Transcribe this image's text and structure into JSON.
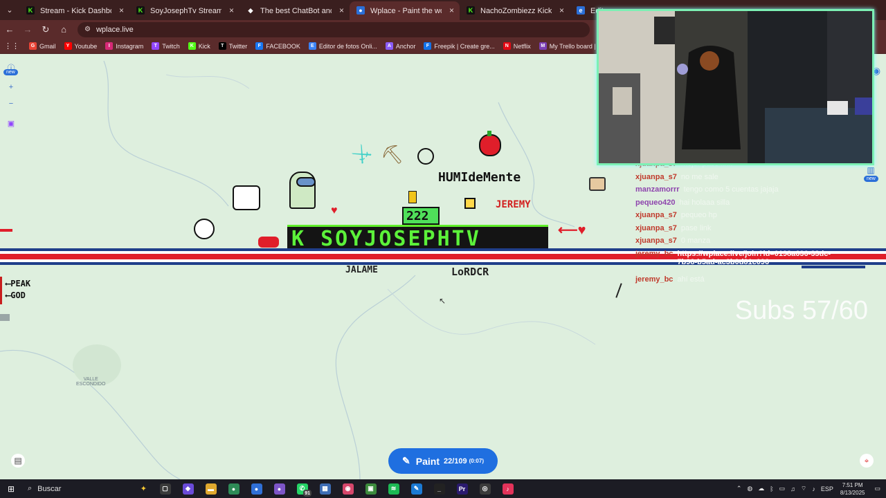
{
  "tabs": [
    {
      "label": "Stream - Kick Dashboard",
      "icon": "kick-icon",
      "active": false
    },
    {
      "label": "SoyJosephTv Stream - Watch Li",
      "icon": "kick-icon",
      "active": false
    },
    {
      "label": "The best ChatBot and Widgets",
      "icon": "botrix-icon",
      "active": false
    },
    {
      "label": "Wplace - Paint the world",
      "icon": "wplace-icon",
      "active": true
    },
    {
      "label": "NachoZombiezz Kick Font by N",
      "icon": "kick-icon",
      "active": false
    },
    {
      "label": "Edito",
      "icon": "edge-icon",
      "active": false
    }
  ],
  "address": {
    "url": "wplace.live"
  },
  "bookmarks": [
    {
      "label": "Gmail",
      "icon": "gmail-icon",
      "color": "#ea4335"
    },
    {
      "label": "Youtube",
      "icon": "youtube-icon",
      "color": "#ff0000"
    },
    {
      "label": "Instagram",
      "icon": "instagram-icon",
      "color": "#d62976"
    },
    {
      "label": "Twitch",
      "icon": "twitch-icon",
      "color": "#9146ff"
    },
    {
      "label": "Kick",
      "icon": "kick-icon",
      "color": "#53fc18"
    },
    {
      "label": "Twitter",
      "icon": "x-icon",
      "color": "#000000"
    },
    {
      "label": "FACEBOOK",
      "icon": "facebook-icon",
      "color": "#1877f2"
    },
    {
      "label": "Editor de fotos Onli...",
      "icon": "editor-icon",
      "color": "#3b82f6"
    },
    {
      "label": "Anchor",
      "icon": "anchor-icon",
      "color": "#8b5cf6"
    },
    {
      "label": "Freepik | Create gre...",
      "icon": "freepik-icon",
      "color": "#1273eb"
    },
    {
      "label": "Netflix",
      "icon": "netflix-icon",
      "color": "#e50914"
    },
    {
      "label": "My Trello board | Tr...",
      "icon": "trello-icon",
      "color": "#7b3fb5"
    },
    {
      "label": "¿Qu",
      "icon": "bookmark-icon",
      "color": "#888888"
    }
  ],
  "map": {
    "side_new_badge": "new",
    "right_new_badge": "new",
    "place_label": "VALLE\nESCONDIDO",
    "banner_text": "K SOYJOSEPHTV",
    "texts": {
      "humildemente": "HUMIdeMente",
      "jeremy": "JEREMY",
      "number": "222",
      "jalame": "JALAME",
      "lordcr": "LoRDCR",
      "peak": "⟵PEAK",
      "god": "⟵GOD"
    }
  },
  "chat": [
    {
      "user": "xjuanpa_s7",
      "color": "#c0392b",
      "msg": "mejor pase link"
    },
    {
      "user": "xjuanpa_s7",
      "color": "#c0392b",
      "msg": "no me sale"
    },
    {
      "user": "manzamorrr",
      "color": "#8e44ad",
      "msg": "tengo como 5 cuentas jajaja"
    },
    {
      "user": "pequeo420",
      "color": "#8e44ad",
      "msg": "hai holaaa silla"
    },
    {
      "user": "xjuanpa_s7",
      "color": "#c0392b",
      "msg": "pequeo hp"
    },
    {
      "user": "xjuanpa_s7",
      "color": "#c0392b",
      "msg": "pase link"
    },
    {
      "user": "xjuanpa_s7",
      "color": "#c0392b",
      "msg": "0 manza"
    },
    {
      "user": "jeremy_bc",
      "color": "#c0392b",
      "msg": "https://wplace.live/join?id=0198a636-33dc-7b98-b5ad-ac3b0d81c096"
    },
    {
      "user": "",
      "color": "#ffffff",
      "msg": ""
    },
    {
      "user": "jeremy_bc",
      "color": "#c0392b",
      "msg": "ahí está"
    }
  ],
  "subs_text": "Subs 57/60",
  "paint": {
    "label": "Paint",
    "count": "22/109",
    "timer": "(0:07)"
  },
  "taskbar": {
    "search_placeholder": "Buscar",
    "apps": [
      {
        "icon": "task-view-icon",
        "color": "#3a3a3a",
        "glyph": "▢"
      },
      {
        "icon": "copilot-icon",
        "color": "#6a4bd8",
        "glyph": "◆"
      },
      {
        "icon": "file-explorer-icon",
        "color": "#e0a82e",
        "glyph": "▬"
      },
      {
        "icon": "chrome-icon",
        "color": "#2e8b57",
        "glyph": "●"
      },
      {
        "icon": "chrome-profile-icon",
        "color": "#2f6fd6",
        "glyph": "●"
      },
      {
        "icon": "chrome-dev-icon",
        "color": "#7d55c7",
        "glyph": "●"
      },
      {
        "icon": "whatsapp-icon",
        "color": "#25d366",
        "glyph": "✆"
      },
      {
        "icon": "calculator-icon",
        "color": "#3e6db5",
        "glyph": "▦"
      },
      {
        "icon": "photos-icon",
        "color": "#d6476b",
        "glyph": "◉"
      },
      {
        "icon": "minecraft-icon",
        "color": "#3d8b3d",
        "glyph": "▣"
      },
      {
        "icon": "spotify-icon",
        "color": "#1db954",
        "glyph": "≋"
      },
      {
        "icon": "notes-icon",
        "color": "#1b7ad4",
        "glyph": "✎"
      },
      {
        "icon": "terminal-icon",
        "color": "#222222",
        "glyph": "_"
      },
      {
        "icon": "premiere-icon",
        "color": "#2a1a6e",
        "glyph": "Pr"
      },
      {
        "icon": "obs-icon",
        "color": "#3b3b3b",
        "glyph": "◎"
      },
      {
        "icon": "capcut-icon",
        "color": "#e3335a",
        "glyph": "♪"
      }
    ],
    "whatsapp_badge": "91",
    "language": "ESP",
    "time": "7:51 PM",
    "date": "8/13/2025"
  }
}
